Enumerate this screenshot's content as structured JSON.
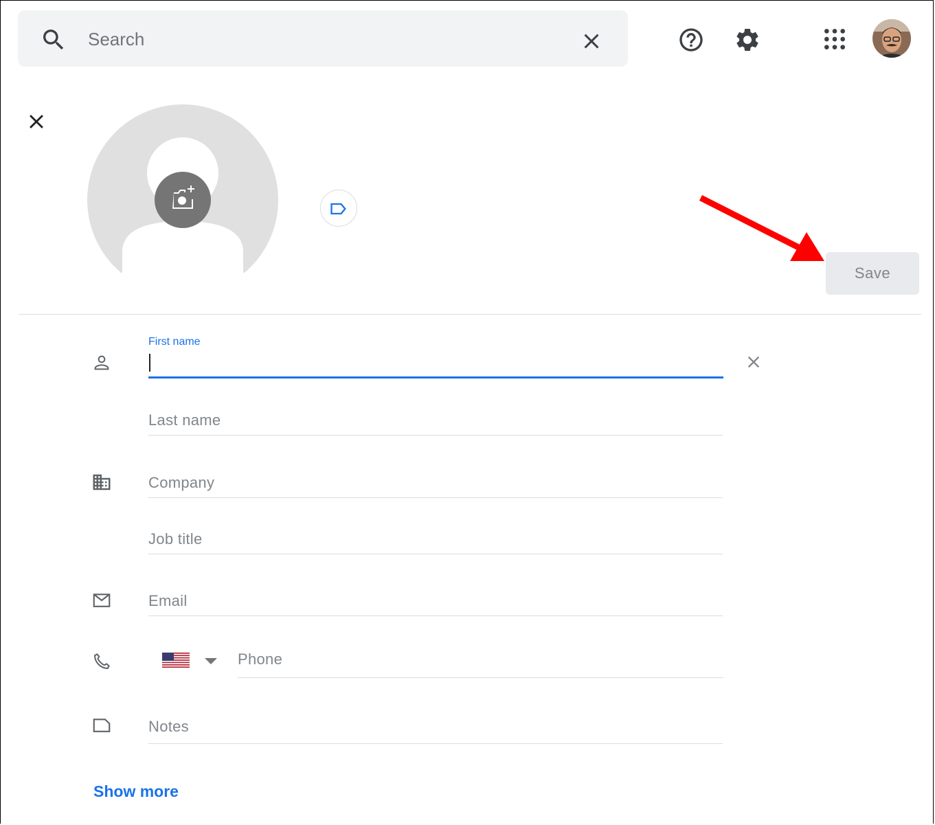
{
  "header": {
    "search": {
      "placeholder": "Search",
      "value": ""
    },
    "icons": [
      "search-icon",
      "close-icon",
      "help-icon",
      "settings-icon",
      "apps-grid-icon"
    ]
  },
  "editor": {
    "icons": [
      "close-icon",
      "add-photo-icon",
      "label-icon"
    ],
    "save_label": "Save"
  },
  "form": {
    "first_name": {
      "label": "First name",
      "value": ""
    },
    "last_name": {
      "placeholder": "Last name"
    },
    "company": {
      "placeholder": "Company"
    },
    "job_title": {
      "placeholder": "Job title"
    },
    "email": {
      "placeholder": "Email"
    },
    "phone": {
      "placeholder": "Phone",
      "country": "US"
    },
    "notes": {
      "placeholder": "Notes"
    },
    "show_more_label": "Show more"
  },
  "colors": {
    "accent": "#1a73e8",
    "annotation_arrow": "#ff0000",
    "placeholder": "#80868b"
  }
}
